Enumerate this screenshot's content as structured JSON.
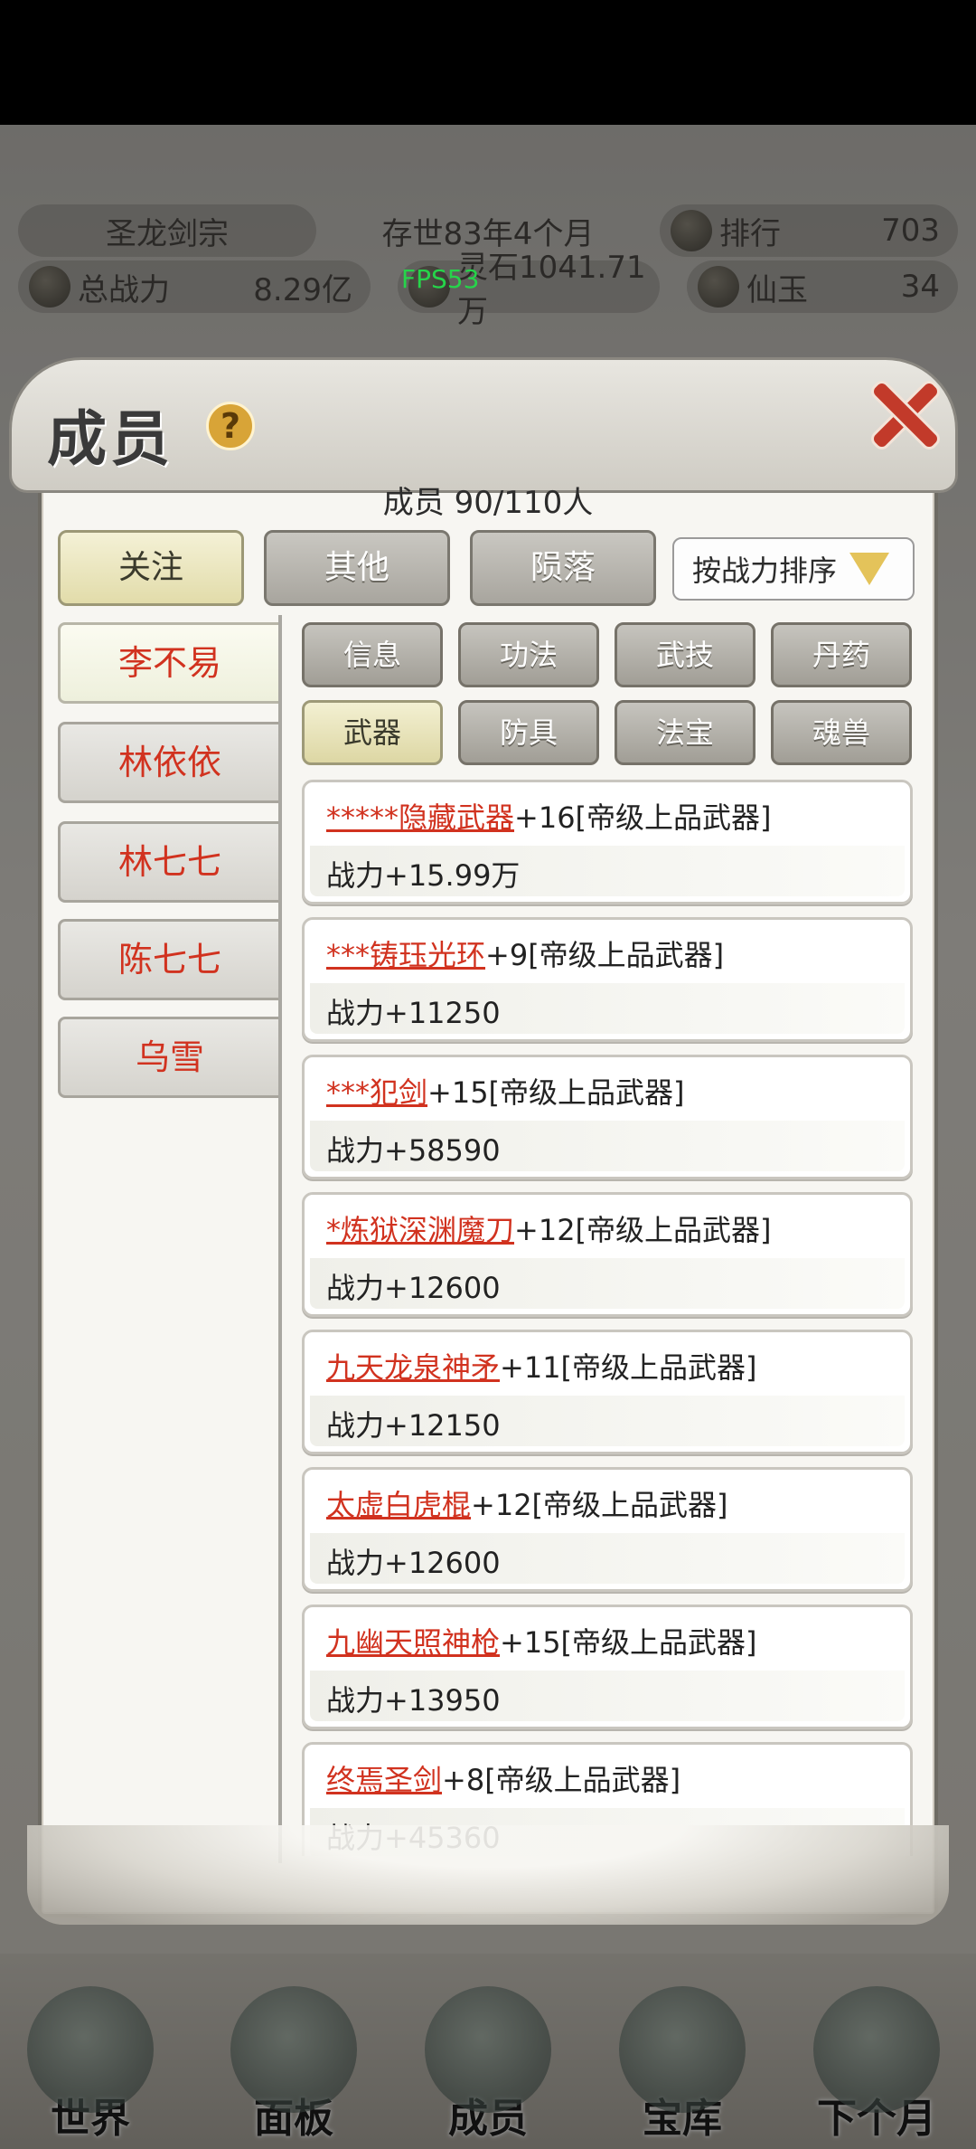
{
  "status": {
    "sect_name": "圣龙剑宗",
    "age": "存世83年4个月",
    "rank_label": "排行",
    "rank_value": "703",
    "power_label": "总战力",
    "power_value": "8.29亿",
    "stone_value": "灵石1041.71万",
    "jade_label": "仙玉",
    "jade_value": "34",
    "fps": "FPS53"
  },
  "panel": {
    "title": "成员",
    "help": "?",
    "count": "成员  90/110人"
  },
  "categories": [
    "关注",
    "其他",
    "陨落"
  ],
  "sort_label": "按战力排序",
  "members": [
    "李不易",
    "林依依",
    "林七七",
    "陈七七",
    "乌雪"
  ],
  "sub_tabs_row1": [
    "信息",
    "功法",
    "武技",
    "丹药"
  ],
  "sub_tabs_row2": [
    "武器",
    "防具",
    "法宝",
    "魂兽"
  ],
  "items": [
    {
      "name": "*****隐藏武器",
      "suffix": "+16[帝级上品武器]",
      "power": "战力+15.99万"
    },
    {
      "name": "***铸珏光环",
      "suffix": "+9[帝级上品武器]",
      "power": "战力+11250"
    },
    {
      "name": "***犯剑",
      "suffix": "+15[帝级上品武器]",
      "power": "战力+58590"
    },
    {
      "name": "*炼狱深渊魔刀",
      "suffix": "+12[帝级上品武器]",
      "power": "战力+12600"
    },
    {
      "name": "九天龙泉神矛",
      "suffix": "+11[帝级上品武器]",
      "power": "战力+12150"
    },
    {
      "name": "太虚白虎棍",
      "suffix": "+12[帝级上品武器]",
      "power": "战力+12600"
    },
    {
      "name": "九幽天照神枪",
      "suffix": "+15[帝级上品武器]",
      "power": "战力+13950"
    },
    {
      "name": "终焉圣剑",
      "suffix": "+8[帝级上品武器]",
      "power": "战力+45360"
    }
  ],
  "nav": [
    "世界",
    "面板",
    "成员",
    "宝库",
    "下个月"
  ]
}
